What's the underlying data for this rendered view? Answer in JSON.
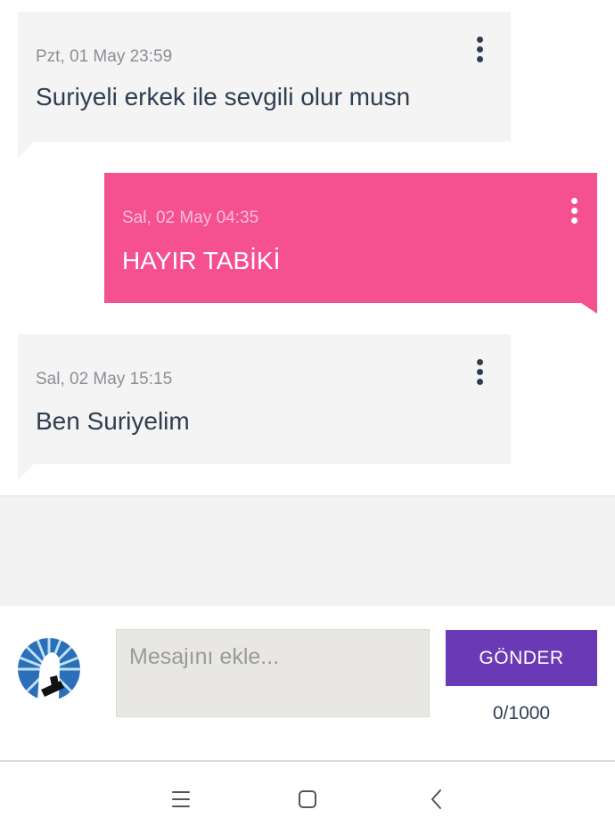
{
  "messages": [
    {
      "timestamp": "Pzt, 01 May 23:59",
      "text": "Suriyeli erkek ile sevgili olur musn",
      "direction": "incoming"
    },
    {
      "timestamp": "Sal, 02 May 04:35",
      "text": "HAYIR TABİKİ",
      "direction": "outgoing"
    },
    {
      "timestamp": "Sal, 02 May 15:15",
      "text": "Ben Suriyelim",
      "direction": "incoming"
    }
  ],
  "composer": {
    "placeholder": "Mesajını ekle...",
    "send_label": "GÖNDER",
    "char_counter": "0/1000"
  },
  "colors": {
    "incoming_bubble": "#f4f4f4",
    "outgoing_bubble": "#f5508f",
    "send_button": "#6a3ab6",
    "text_dark": "#2f3e4f"
  },
  "icons": {
    "message_menu": "more-vert-icon",
    "nav_menu": "menu-icon",
    "nav_home": "home-square-icon",
    "nav_back": "back-chevron-icon"
  }
}
